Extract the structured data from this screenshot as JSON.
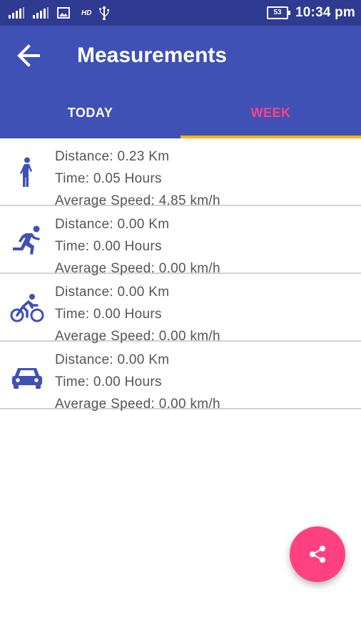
{
  "status_bar": {
    "hd_label": "HD",
    "battery": "53",
    "time": "10:34 pm",
    "icons": [
      "signal-icon",
      "signal-icon",
      "image-icon",
      "usb-icon"
    ]
  },
  "app_bar": {
    "title": "Measurements",
    "back_icon": "arrow-back-icon",
    "tabs": [
      {
        "label": "TODAY",
        "selected": false
      },
      {
        "label": "WEEK",
        "selected": true
      }
    ]
  },
  "activities": [
    {
      "icon": "walk-icon",
      "distance": "Distance: 0.23 Km",
      "time": "Time: 0.05 Hours",
      "speed": "Average Speed: 4.85 km/h"
    },
    {
      "icon": "run-icon",
      "distance": "Distance: 0.00 Km",
      "time": "Time: 0.00 Hours",
      "speed": "Average Speed: 0.00 km/h"
    },
    {
      "icon": "bike-icon",
      "distance": "Distance: 0.00 Km",
      "time": "Time: 0.00 Hours",
      "speed": "Average Speed: 0.00 km/h"
    },
    {
      "icon": "car-icon",
      "distance": "Distance: 0.00 Km",
      "time": "Time: 0.00 Hours",
      "speed": "Average Speed: 0.00 km/h"
    }
  ],
  "fab": {
    "icon": "share-icon"
  },
  "colors": {
    "primary": "#3f51b5",
    "primary_dark": "#2f3b91",
    "accent": "#ff4081",
    "tab_indicator": "#ffb300",
    "icon": "#3f51b5"
  }
}
